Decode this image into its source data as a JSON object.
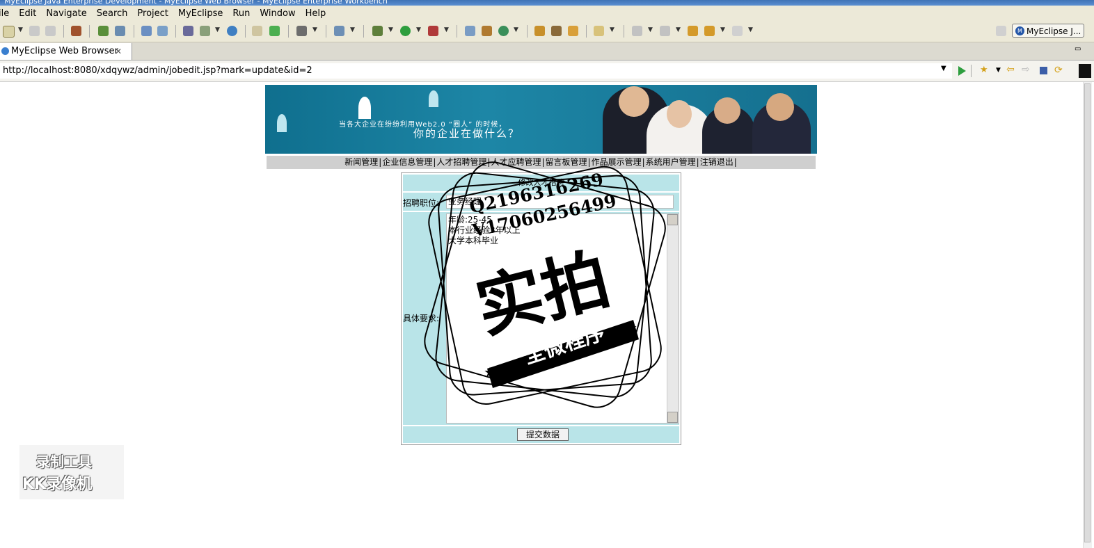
{
  "window": {
    "title": "MyEclipse Java Enterprise Development - MyEclipse Web Browser - MyEclipse Enterprise Workbench"
  },
  "menu": [
    "ile",
    "Edit",
    "Navigate",
    "Search",
    "Project",
    "MyEclipse",
    "Run",
    "Window",
    "Help"
  ],
  "perspective": {
    "label": "MyEclipse J...",
    "icon": "myeclipse-perspective-icon"
  },
  "editor_tab": {
    "label": "MyEclipse Web Browser",
    "close_icon": "close-icon"
  },
  "address": {
    "url": "http://localhost:8080/xdqywz/admin/jobedit.jsp?mark=update&id=2"
  },
  "banner": {
    "slogan_small": "当各大企业在纷纷利用Web2.0 “圈人” 的时候，",
    "slogan_large": "你的企业在做什么？"
  },
  "nav": [
    "新闻管理",
    "企业信息管理",
    "人才招聘管理",
    "人才应聘管理",
    "留言板管理",
    "作品展示管理",
    "系统用户管理",
    "注销退出"
  ],
  "nav_separator": "|",
  "form": {
    "header": "修改人才招聘",
    "position_label": "招聘职位:",
    "position_value": "业务经理",
    "requirements_label": "具体要求:",
    "requirements_lines": [
      "年龄:25-45",
      "本行业经验3年以上",
      "大学本科毕业"
    ],
    "submit_label": "提交数据"
  },
  "watermark": {
    "qq": "Q2196316269",
    "vx": "V17060256499",
    "big_text": "实拍",
    "ribbon_text": "全微程序"
  },
  "recorder_watermark": {
    "line1": "录制工具",
    "line2": "KK录像机"
  }
}
